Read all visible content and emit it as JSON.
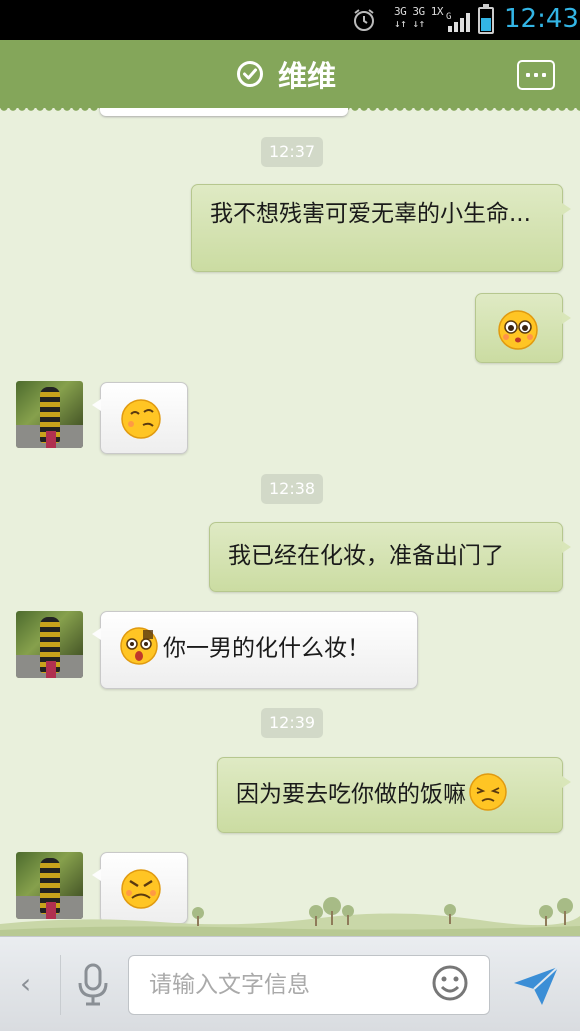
{
  "status_bar": {
    "net_top": "3G 3G 1X",
    "net_bottom": "↓↑ ↓↑",
    "net_g": "G",
    "time": "12:43"
  },
  "header": {
    "title": "维维",
    "online_icon": "check-circle-icon",
    "menu_icon": "more-icon"
  },
  "chat": {
    "timestamps": [
      "12:37",
      "12:38",
      "12:39"
    ],
    "messages": [
      {
        "dir": "out",
        "type": "text",
        "text": "我不想残害可爱无辜的小生命..."
      },
      {
        "dir": "out",
        "type": "emoji",
        "emoji": "pitiful-face-emoji"
      },
      {
        "dir": "in",
        "type": "emoji",
        "emoji": "smug-face-emoji"
      },
      {
        "dir": "out",
        "type": "text",
        "text": "我已经在化妆，准备出门了"
      },
      {
        "dir": "in",
        "type": "text",
        "text": "你一男的化什么妆！",
        "emoji": "shocked-face-emoji"
      },
      {
        "dir": "out",
        "type": "text",
        "text": "因为要去吃你做的饭嘛",
        "emoji": "blissful-face-emoji"
      },
      {
        "dir": "in",
        "type": "emoji",
        "emoji": "angry-face-emoji"
      }
    ]
  },
  "input_bar": {
    "placeholder": "请输入文字信息",
    "back_icon": "chevron-left-icon",
    "voice_icon": "microphone-icon",
    "emoji_icon": "smiley-icon",
    "send_icon": "send-icon"
  },
  "colors": {
    "title_bar": "#84a65a",
    "background": "#e9f0dc",
    "outgoing_bubble": "#d4e2b2",
    "clock_blue": "#33b5e5"
  }
}
